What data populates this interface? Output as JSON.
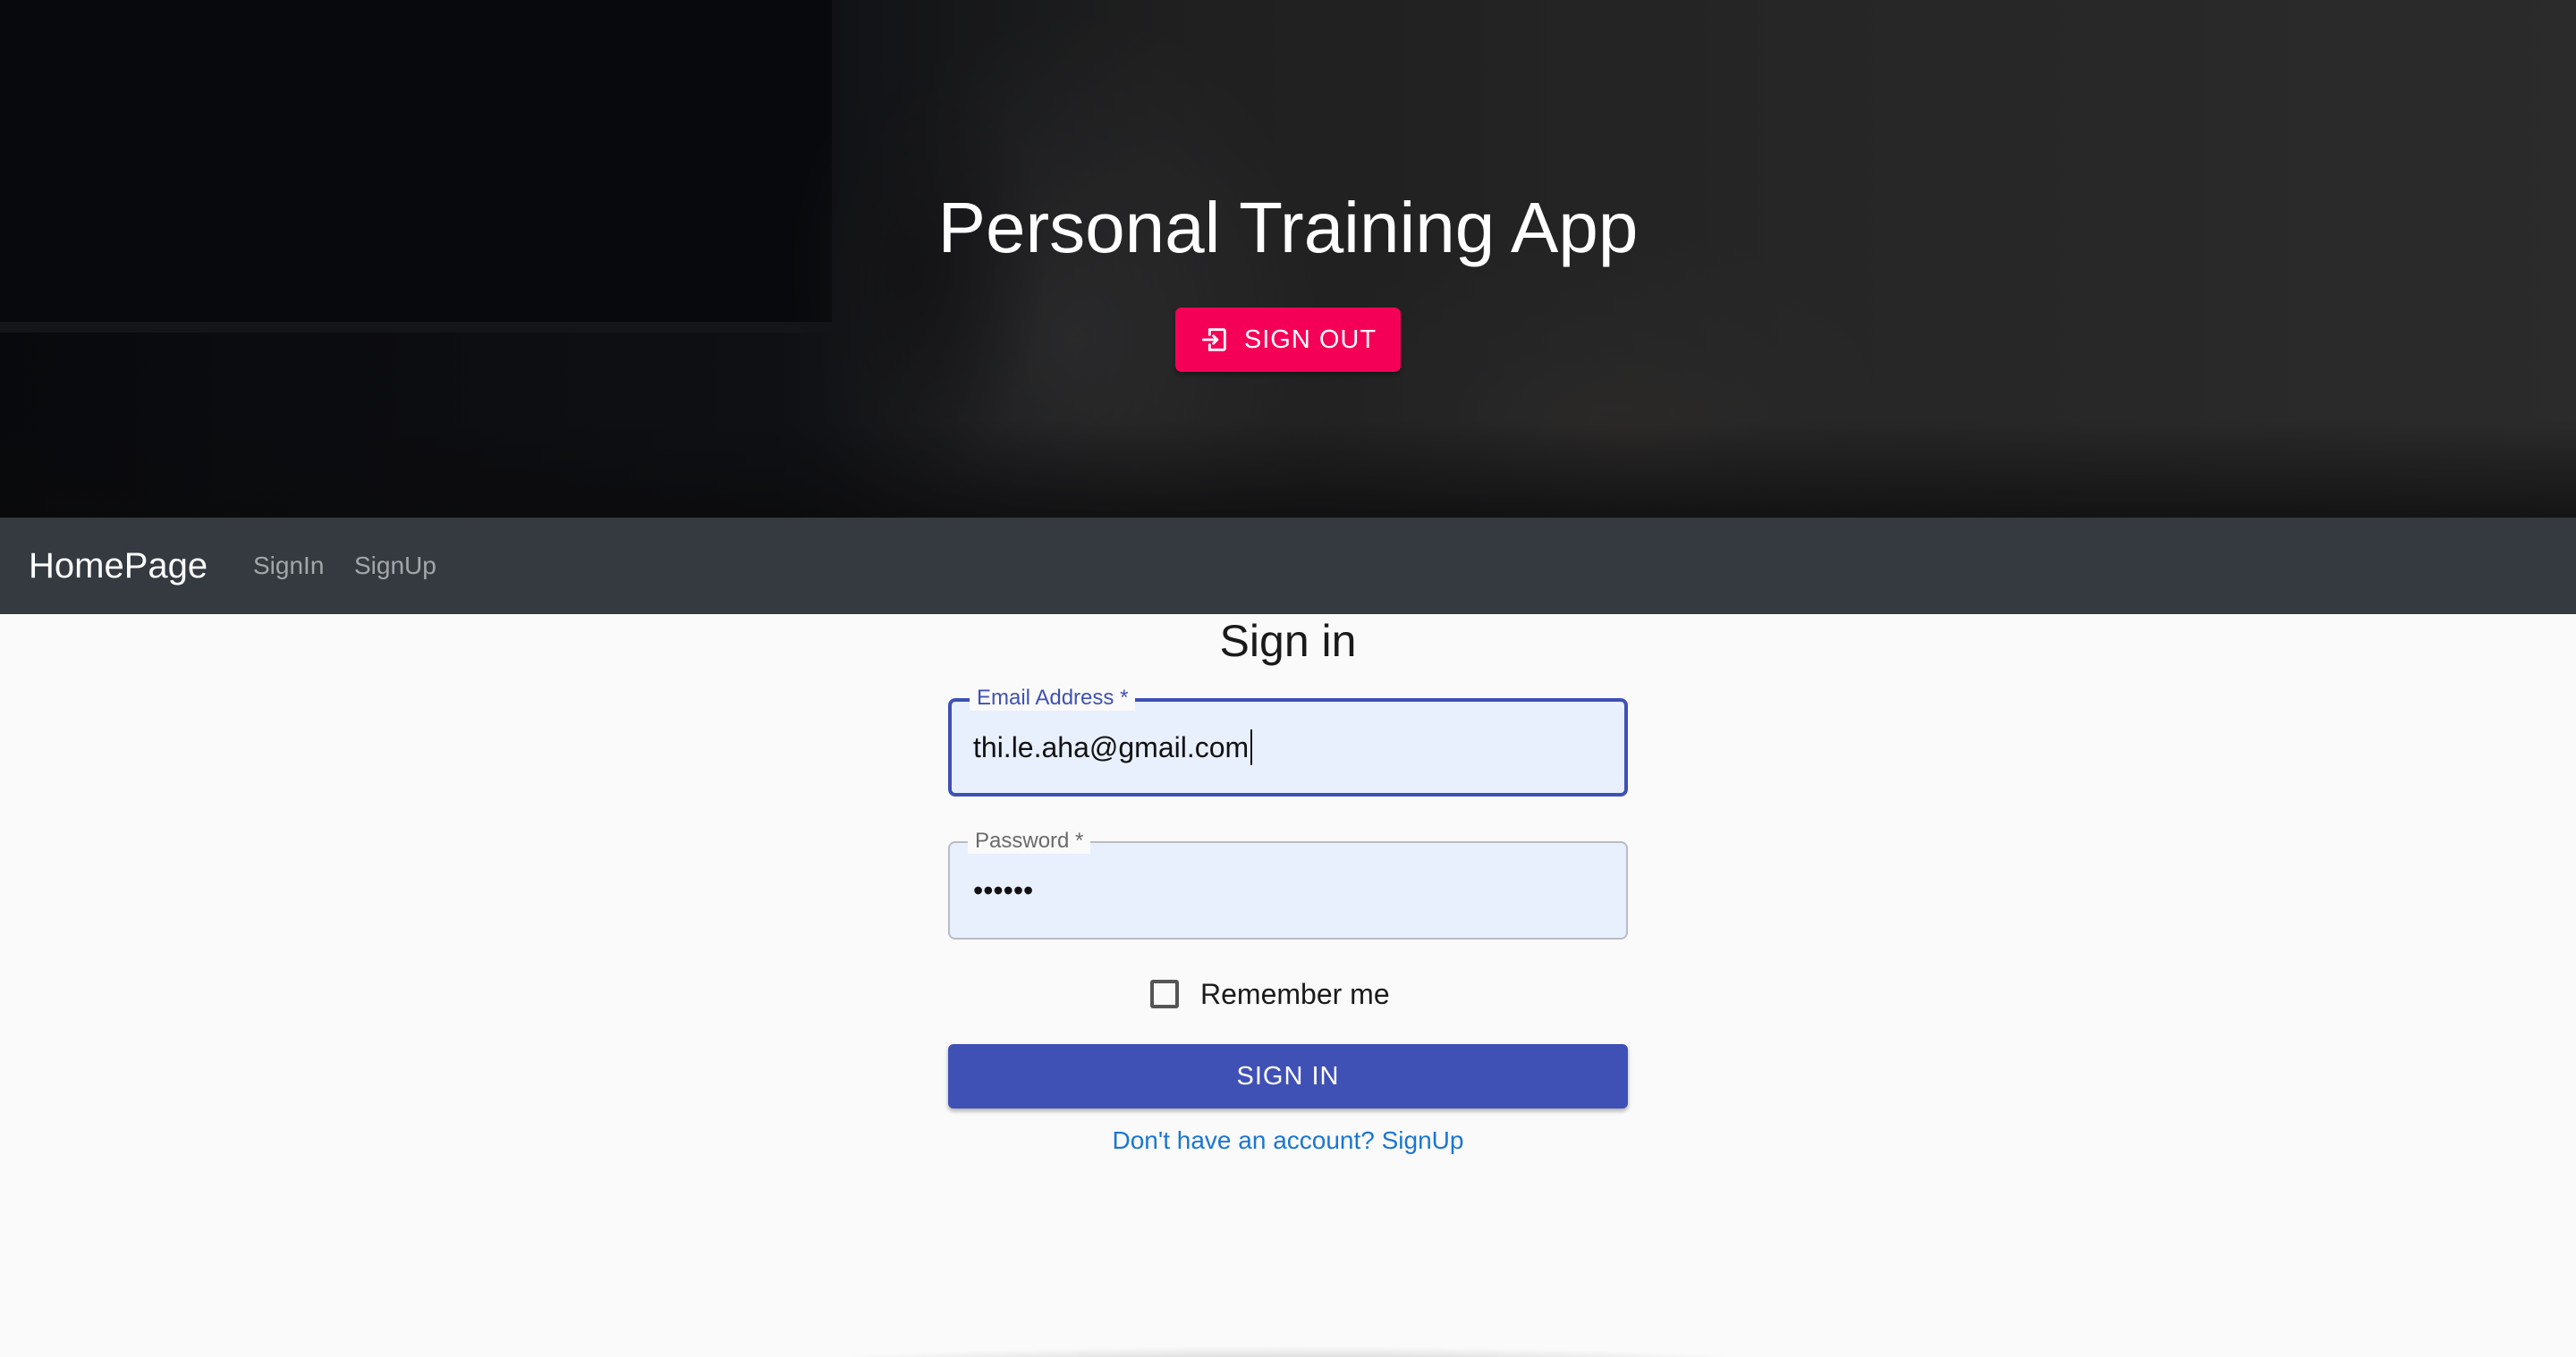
{
  "hero": {
    "title": "Personal Training App",
    "signout_label": "SIGN OUT",
    "signout_icon": "sign-out-icon",
    "signout_color": "#f50057",
    "background": "dark gym photo with trainer and client exercising"
  },
  "navbar": {
    "brand": "HomePage",
    "links": [
      {
        "label": "SignIn"
      },
      {
        "label": "SignUp"
      }
    ],
    "background_color": "#343a40"
  },
  "form": {
    "title": "Sign in",
    "email": {
      "label": "Email Address",
      "required_mark": "*",
      "value": "thi.le.aha@gmail.com",
      "focused": true
    },
    "password": {
      "label": "Password",
      "required_mark": "*",
      "value": "••••••"
    },
    "remember": {
      "label": "Remember me",
      "checked": false
    },
    "submit_label": "SIGN IN",
    "submit_color": "#3f51b5",
    "signup_link": "Don't have an account? SignUp",
    "link_color": "#1976d2"
  }
}
